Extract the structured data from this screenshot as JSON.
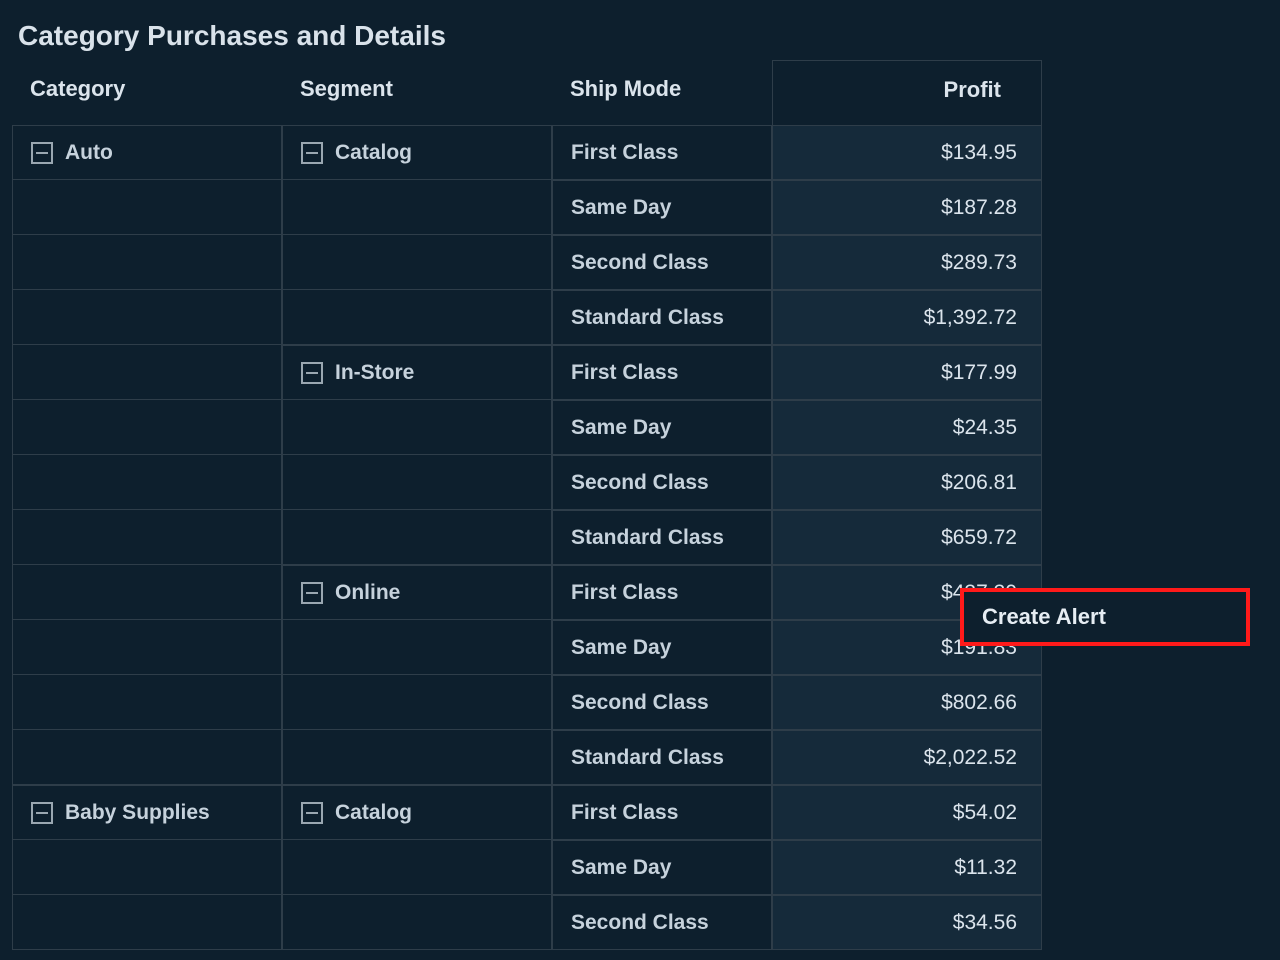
{
  "title": "Category Purchases and Details",
  "headers": {
    "category": "Category",
    "segment": "Segment",
    "shipmode": "Ship Mode",
    "profit": "Profit"
  },
  "context_menu": {
    "create_alert": "Create Alert"
  },
  "rows": [
    {
      "category": "Auto",
      "segment": "Catalog",
      "shipmode": "First Class",
      "profit": "$134.95"
    },
    {
      "category": "",
      "segment": "",
      "shipmode": "Same Day",
      "profit": "$187.28"
    },
    {
      "category": "",
      "segment": "",
      "shipmode": "Second Class",
      "profit": "$289.73"
    },
    {
      "category": "",
      "segment": "",
      "shipmode": "Standard Class",
      "profit": "$1,392.72"
    },
    {
      "category": "",
      "segment": "In-Store",
      "shipmode": "First Class",
      "profit": "$177.99"
    },
    {
      "category": "",
      "segment": "",
      "shipmode": "Same Day",
      "profit": "$24.35"
    },
    {
      "category": "",
      "segment": "",
      "shipmode": "Second Class",
      "profit": "$206.81"
    },
    {
      "category": "",
      "segment": "",
      "shipmode": "Standard Class",
      "profit": "$659.72"
    },
    {
      "category": "",
      "segment": "Online",
      "shipmode": "First Class",
      "profit": "$437.30"
    },
    {
      "category": "",
      "segment": "",
      "shipmode": "Same Day",
      "profit": "$191.83"
    },
    {
      "category": "",
      "segment": "",
      "shipmode": "Second Class",
      "profit": "$802.66"
    },
    {
      "category": "",
      "segment": "",
      "shipmode": "Standard Class",
      "profit": "$2,022.52"
    },
    {
      "category": "Baby Supplies",
      "segment": "Catalog",
      "shipmode": "First Class",
      "profit": "$54.02"
    },
    {
      "category": "",
      "segment": "",
      "shipmode": "Same Day",
      "profit": "$11.32"
    },
    {
      "category": "",
      "segment": "",
      "shipmode": "Second Class",
      "profit": "$34.56"
    }
  ]
}
